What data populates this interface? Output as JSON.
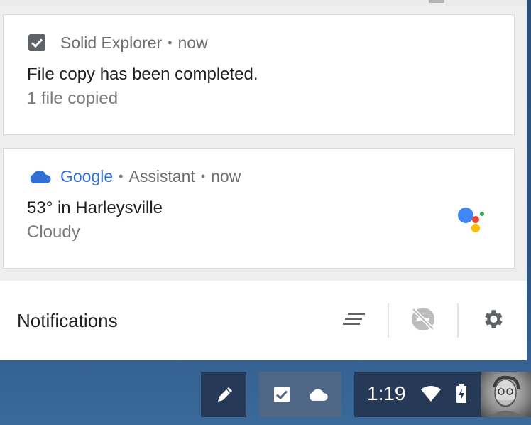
{
  "notifications": [
    {
      "app_name": "Solid Explorer",
      "separator": "•",
      "time": "now",
      "title": "File copy has been completed.",
      "subtitle": "1 file copied",
      "icon": "checkbox-icon"
    },
    {
      "app_name": "Google",
      "separator": "•",
      "source": "Assistant",
      "separator2": "•",
      "time": "now",
      "title": "53° in Harleysville",
      "subtitle": "Cloudy",
      "icon": "cloud-icon",
      "accent": "#2f6fd6"
    }
  ],
  "footer": {
    "title": "Notifications",
    "clear_icon": "clear-all-icon",
    "dnd_icon": "do-not-disturb-icon",
    "settings_icon": "gear-icon"
  },
  "shelf": {
    "clock": "1:19",
    "stylus_icon": "stylus-icon",
    "notification_icons": [
      "checkbox-icon",
      "cloud-icon"
    ],
    "status_icons": [
      "wifi-icon",
      "battery-charging-icon"
    ]
  },
  "colors": {
    "google_blue": "#2f6fd6",
    "assistant_blue": "#4285f4",
    "assistant_red": "#ea4335",
    "assistant_yellow": "#fbbc05",
    "assistant_green": "#34a853"
  }
}
